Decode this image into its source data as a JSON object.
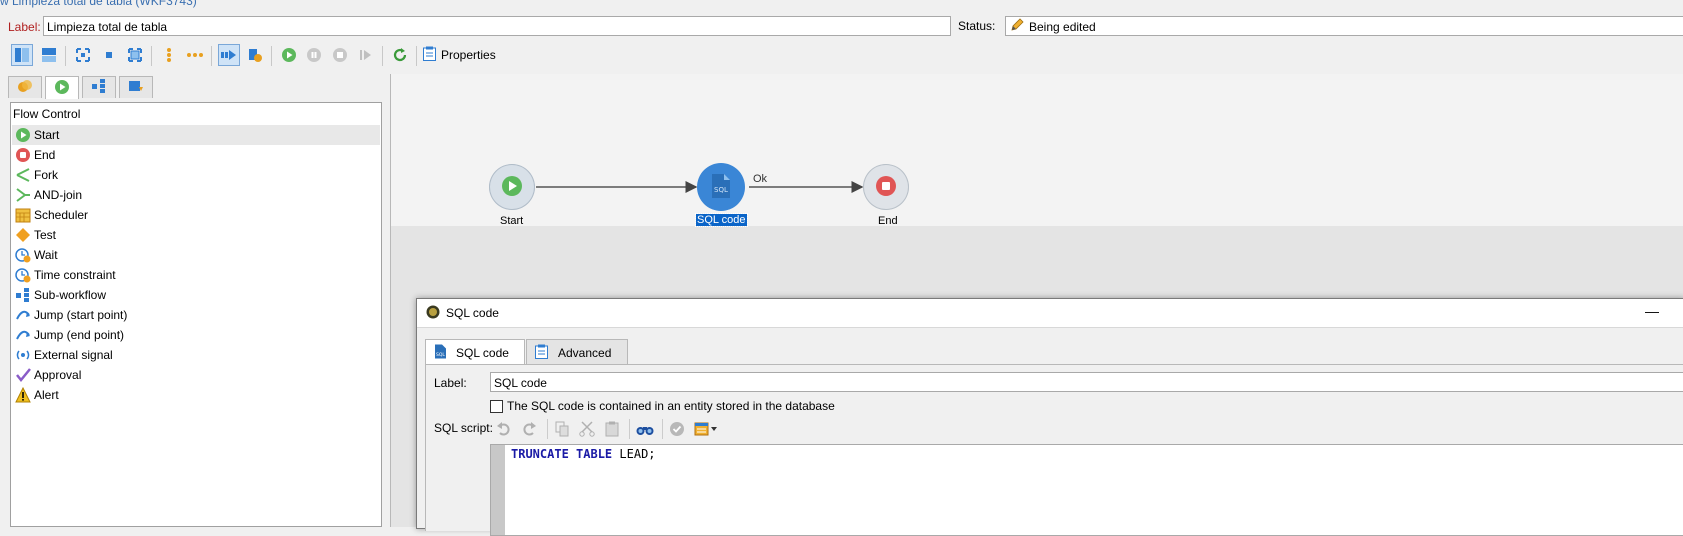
{
  "window": {
    "title": "w  Limpieza total de tabla (WKF3743)"
  },
  "header": {
    "label_caption": "Label:",
    "label_value": "Limpieza total de tabla",
    "status_caption": "Status:",
    "status_value": "Being edited"
  },
  "toolbar": {
    "properties_label": "Properties",
    "icons": [
      "layout-vertical-icon",
      "layout-horizontal-icon",
      "fit-icon",
      "node-icon",
      "frame-icon",
      "vertical-dots-icon",
      "horizontal-dots-icon",
      "auto-link-icon",
      "properties-check-icon",
      "start-icon",
      "pause-icon",
      "stop-icon",
      "step-icon",
      "refresh-icon"
    ]
  },
  "palette": {
    "tabs": [
      "targeting-icon",
      "flow-control-icon",
      "actions-icon",
      "events-icon"
    ],
    "section_title": "Flow Control",
    "items": [
      {
        "label": "Start",
        "icon": "start-icon"
      },
      {
        "label": "End",
        "icon": "end-icon"
      },
      {
        "label": "Fork",
        "icon": "fork-icon"
      },
      {
        "label": "AND-join",
        "icon": "and-join-icon"
      },
      {
        "label": "Scheduler",
        "icon": "scheduler-icon"
      },
      {
        "label": "Test",
        "icon": "test-icon"
      },
      {
        "label": "Wait",
        "icon": "wait-icon"
      },
      {
        "label": "Time constraint",
        "icon": "time-constraint-icon"
      },
      {
        "label": "Sub-workflow",
        "icon": "sub-workflow-icon"
      },
      {
        "label": "Jump (start point)",
        "icon": "jump-start-icon"
      },
      {
        "label": "Jump (end point)",
        "icon": "jump-end-icon"
      },
      {
        "label": "External signal",
        "icon": "external-signal-icon"
      },
      {
        "label": "Approval",
        "icon": "approval-icon"
      },
      {
        "label": "Alert",
        "icon": "alert-icon"
      }
    ]
  },
  "workflow": {
    "nodes": [
      {
        "label": "Start"
      },
      {
        "label": "SQL code"
      },
      {
        "label": "End"
      }
    ],
    "transition_label": "Ok"
  },
  "dialog": {
    "title": "SQL code",
    "minimize": "—",
    "tabs": [
      "SQL code",
      "Advanced"
    ],
    "label_caption": "Label:",
    "label_value": "SQL code",
    "checkbox_label": "The SQL code is contained in an entity stored in the database",
    "script_caption": "SQL script:",
    "code_keyword1": "TRUNCATE",
    "code_keyword2": "TABLE",
    "code_rest": "LEAD;"
  },
  "colors": {
    "accent_blue": "#3a86d6",
    "start_green": "#5cb85c",
    "end_red": "#e05555",
    "selection": "#0a64c8"
  }
}
